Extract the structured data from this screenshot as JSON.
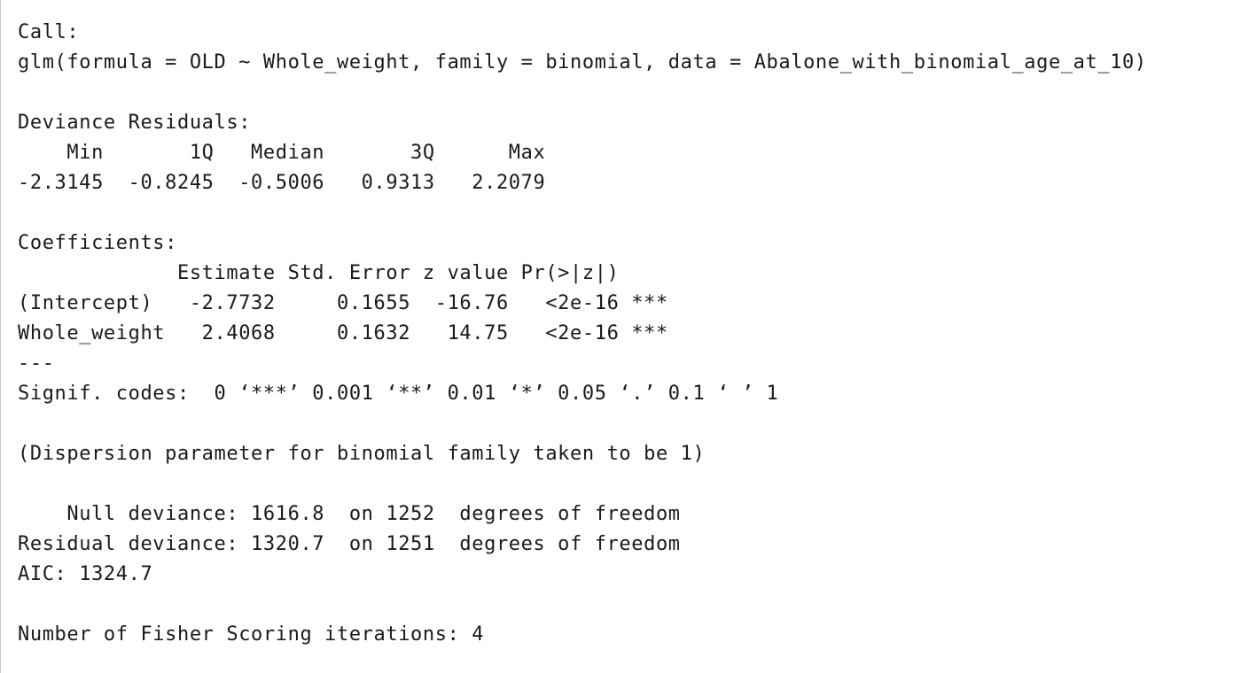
{
  "output": {
    "lines": [
      "Call:",
      "glm(formula = OLD ~ Whole_weight, family = binomial, data = Abalone_with_binomial_age_at_10)",
      "",
      "Deviance Residuals: ",
      "    Min       1Q   Median       3Q      Max  ",
      "-2.3145  -0.8245  -0.5006   0.9313   2.2079  ",
      "",
      "Coefficients:",
      "             Estimate Std. Error z value Pr(>|z|)    ",
      "(Intercept)   -2.7732     0.1655  -16.76   <2e-16 ***",
      "Whole_weight   2.4068     0.1632   14.75   <2e-16 ***",
      "---",
      "Signif. codes:  0 ‘***’ 0.001 ‘**’ 0.01 ‘*’ 0.05 ‘.’ 0.1 ‘ ’ 1",
      "",
      "(Dispersion parameter for binomial family taken to be 1)",
      "",
      "    Null deviance: 1616.8  on 1252  degrees of freedom",
      "Residual deviance: 1320.7  on 1251  degrees of freedom",
      "AIC: 1324.7",
      "",
      "Number of Fisher Scoring iterations: 4"
    ]
  }
}
